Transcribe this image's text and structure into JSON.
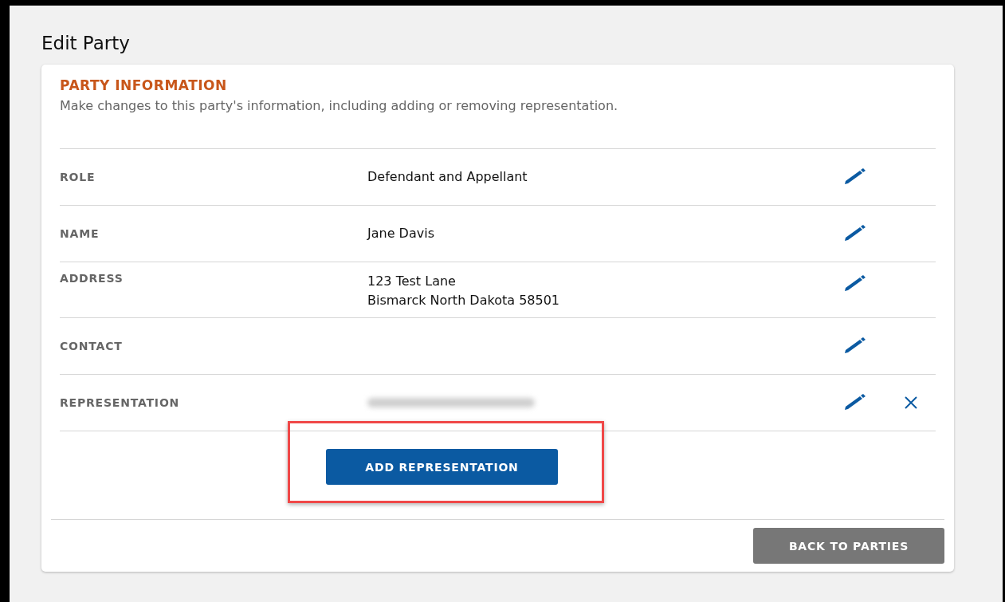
{
  "page": {
    "title": "Edit Party"
  },
  "section": {
    "heading": "PARTY INFORMATION",
    "description": "Make changes to this party's information, including adding or removing representation."
  },
  "fields": [
    {
      "label": "ROLE",
      "value_lines": [
        "Defendant and Appellant"
      ],
      "redacted": false,
      "removable": false
    },
    {
      "label": "NAME",
      "value_lines": [
        "Jane Davis"
      ],
      "redacted": false,
      "removable": false
    },
    {
      "label": "ADDRESS",
      "value_lines": [
        "123 Test Lane",
        "Bismarck North Dakota 58501"
      ],
      "redacted": false,
      "removable": false
    },
    {
      "label": "CONTACT",
      "redacted": false,
      "removable": false
    },
    {
      "label": "REPRESENTATION",
      "redacted": true,
      "removable": true
    }
  ],
  "add_button": {
    "label": "ADD REPRESENTATION",
    "highlighted": true
  },
  "footer_button": {
    "label": "BACK TO PARTIES"
  }
}
